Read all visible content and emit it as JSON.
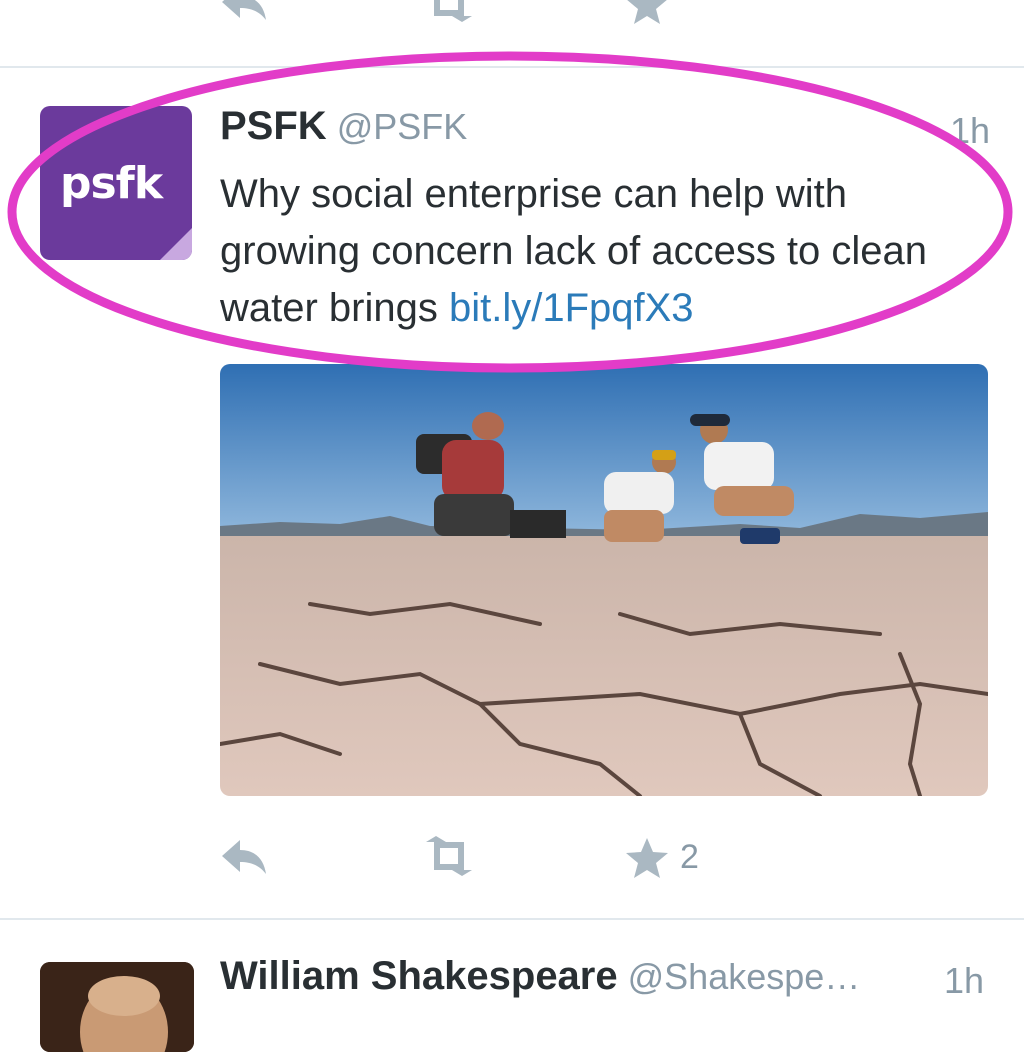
{
  "top_actions": {
    "reply_icon": "reply-icon",
    "retweet_icon": "retweet-icon",
    "favorite_icon": "star-icon"
  },
  "tweet1": {
    "display_name": "PSFK",
    "handle": "@PSFK",
    "time": "1h",
    "avatar_text": "psfk",
    "text": "Why social enterprise can help with growing concern lack of access to clean water brings ",
    "link": "bit.ly/1FpqfX3",
    "favorite_count": "2",
    "colors": {
      "avatar_bg": "#6b3a9c",
      "link": "#2b7bb9",
      "highlight": "#e23cc8"
    }
  },
  "tweet2": {
    "display_name": "William Shakespeare",
    "handle": "@Shakespe…",
    "time": "1h"
  }
}
